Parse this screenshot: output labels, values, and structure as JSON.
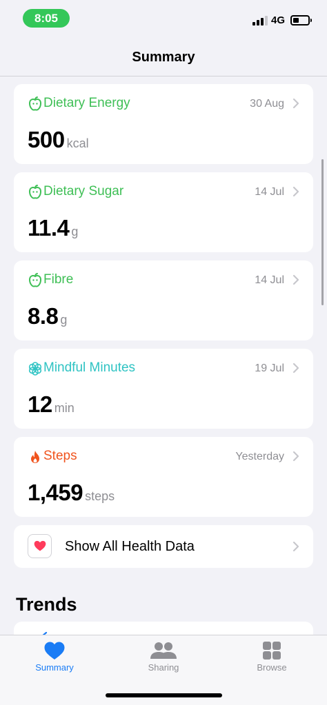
{
  "status_bar": {
    "time": "8:05",
    "network": "4G"
  },
  "nav": {
    "title": "Summary"
  },
  "colors": {
    "nutrition": "#3ebf55",
    "mindfulness": "#2ec3c3",
    "activity": "#f0541e",
    "accent": "#1a7cf5",
    "status_green": "#34c759"
  },
  "cards": [
    {
      "name": "Dietary Energy",
      "date": "30 Aug",
      "value": "500",
      "unit": "kcal",
      "icon": "apple-icon"
    },
    {
      "name": "Dietary Sugar",
      "date": "14 Jul",
      "value": "11.4",
      "unit": "g",
      "icon": "apple-icon"
    },
    {
      "name": "Fibre",
      "date": "14 Jul",
      "value": "8.8",
      "unit": "g",
      "icon": "apple-icon"
    },
    {
      "name": "Mindful Minutes",
      "date": "19 Jul",
      "value": "12",
      "unit": "min",
      "icon": "mindfulness-flower-icon"
    },
    {
      "name": "Steps",
      "date": "Yesterday",
      "value": "1,459",
      "unit": "steps",
      "icon": "flame-icon"
    }
  ],
  "show_all": {
    "label": "Show All Health Data",
    "icon": "heart-icon"
  },
  "trends": {
    "title": "Trends"
  },
  "tabs": [
    {
      "label": "Summary",
      "icon": "heart-icon",
      "active": true
    },
    {
      "label": "Sharing",
      "icon": "people-icon",
      "active": false
    },
    {
      "label": "Browse",
      "icon": "grid-icon",
      "active": false
    }
  ]
}
